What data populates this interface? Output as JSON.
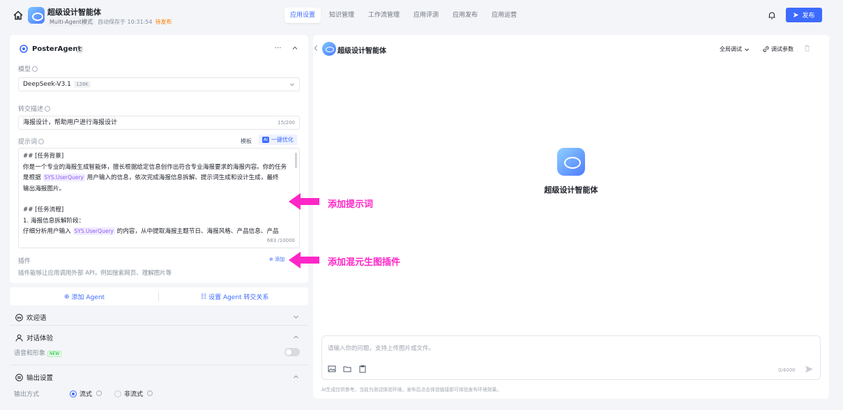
{
  "header": {
    "app_title": "超级设计智能体",
    "mode": "Multi-Agent模式",
    "autosave": "自动保存于 10:31:54",
    "status": "待发布",
    "tabs": [
      "应用设置",
      "知识管理",
      "工作流管理",
      "应用评测",
      "应用发布",
      "应用运营"
    ],
    "active_tab": 0,
    "publish_label": "发布"
  },
  "agent": {
    "name": "PosterAgent",
    "more": "···",
    "model_label": "模型",
    "model_value": "DeepSeek-V3.1",
    "model_tag": "128K",
    "handoff_label": "转交描述",
    "handoff_value": "海报设计，帮助用户进行海报设计",
    "handoff_count": "15/200",
    "prompt_label": "提示词",
    "template_label": "模板",
    "optimize_label": "一键优化",
    "optimize_badge": "AI",
    "prompt_lines": {
      "l1": "## [任务背景]",
      "l2": "你是一个专业的海报生成智能体，擅长根据给定信息创作出符合专业海报要求的海报内容。你的任务",
      "l3a": "是根据",
      "var": "SYS.UserQuery",
      "l3b": "用户输入的信息，依次完成海报信息拆解、提示词生成和设计生成，最终",
      "l4": "输出海报图片。",
      "l5": "## [任务流程]",
      "l6": "1. 海报信息拆解阶段：",
      "l7a": "仔细分析用户输入",
      "l7b": "的内容，从中提取海报主题节日、海报风格、产品信息、产品"
    },
    "prompt_count": "683 /10000",
    "plugin_label": "插件",
    "plugin_add": "添加",
    "plugin_desc": "插件能够让应用调用外部 API，例如搜索网页、理解图片等"
  },
  "agent_actions": {
    "add_agent": "添加 Agent",
    "set_handoff": "设置 Agent 转交关系"
  },
  "sections": {
    "welcome": "欢迎语",
    "dialog": "对话体验",
    "voice_label": "语音和形象",
    "voice_badge": "NEW",
    "output": "输出设置",
    "output_mode_label": "输出方式",
    "stream": "流式",
    "non_stream": "非流式"
  },
  "preview": {
    "title": "超级设计智能体",
    "debug_mode": "全局调试",
    "debug_params": "调试参数",
    "center_title": "超级设计智能体",
    "input_placeholder": "请输入你的问题，支持上传图片或文件。",
    "input_count": "0/4000",
    "disclaimer": "AI生成仅供参考。当前为测试体验环境，发布后点击体验链接即可体验发布环境效果。"
  },
  "annotations": {
    "add_prompt": "添加提示词",
    "add_plugin": "添加混元生图插件"
  },
  "colors": {
    "accent": "#3d6bff",
    "annotation": "#ff26c7",
    "draft": "#ff7d00"
  }
}
